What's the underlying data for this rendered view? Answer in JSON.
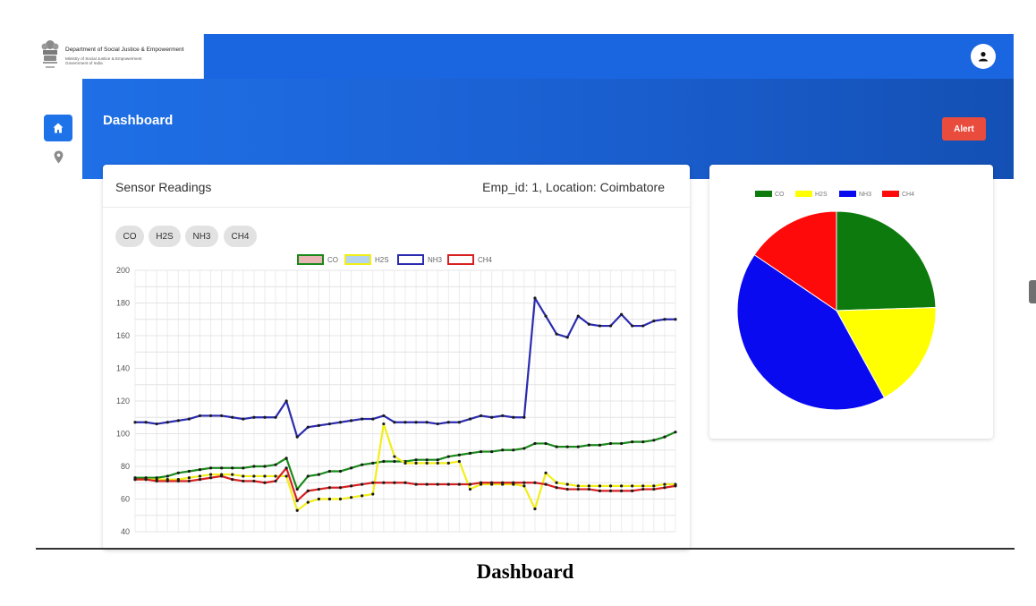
{
  "header": {
    "logo": {
      "title": "Department of Social Justice & Empowerment",
      "line2": "Ministry of Social Justice & Empowerment",
      "line3": "Government of India",
      "emblem_icon": "state-emblem-icon"
    },
    "user_icon": "user-icon",
    "color": "#1a66e0"
  },
  "sidebar": {
    "items": [
      {
        "icon": "home-icon",
        "active": true
      },
      {
        "icon": "location-pin-icon",
        "active": false
      }
    ]
  },
  "page": {
    "title": "Dashboard",
    "alert_label": "Alert",
    "alert_color": "#e94b3c"
  },
  "sensor_card": {
    "title": "Sensor Readings",
    "meta": "Emp_id: 1, Location: Coimbatore",
    "chips": [
      "CO",
      "H2S",
      "NH3",
      "CH4"
    ]
  },
  "chart_data": [
    {
      "type": "line",
      "legend": [
        "CO",
        "H2S",
        "NH3",
        "CH4"
      ],
      "legend_position": "top",
      "ylim": [
        40,
        200
      ],
      "yticks": [
        40,
        60,
        80,
        100,
        120,
        140,
        160,
        180,
        200
      ],
      "grid": true,
      "series": [
        {
          "name": "CO",
          "color": "#1a8a1a",
          "values": [
            73,
            73,
            73,
            74,
            76,
            77,
            78,
            79,
            79,
            79,
            79,
            80,
            80,
            81,
            85,
            66,
            74,
            75,
            77,
            77,
            79,
            81,
            82,
            83,
            83,
            83,
            84,
            84,
            84,
            86,
            87,
            88,
            89,
            89,
            90,
            90,
            91,
            94,
            94,
            92,
            92,
            92,
            93,
            93,
            94,
            94,
            95,
            95,
            96,
            98,
            101
          ]
        },
        {
          "name": "H2S",
          "color": "#f2ee1a",
          "values": [
            72,
            72,
            72,
            72,
            72,
            73,
            74,
            75,
            75,
            75,
            74,
            74,
            74,
            74,
            74,
            53,
            58,
            60,
            60,
            60,
            61,
            62,
            63,
            106,
            86,
            82,
            82,
            82,
            82,
            82,
            83,
            66,
            69,
            69,
            69,
            69,
            68,
            54,
            76,
            70,
            69,
            68,
            68,
            68,
            68,
            68,
            68,
            68,
            68,
            69,
            69
          ]
        },
        {
          "name": "NH3",
          "color": "#2b2bb0",
          "values": [
            107,
            107,
            106,
            107,
            108,
            109,
            111,
            111,
            111,
            110,
            109,
            110,
            110,
            110,
            120,
            98,
            104,
            105,
            106,
            107,
            108,
            109,
            109,
            111,
            107,
            107,
            107,
            107,
            106,
            107,
            107,
            109,
            111,
            110,
            111,
            110,
            110,
            183,
            172,
            161,
            159,
            172,
            167,
            166,
            166,
            173,
            166,
            166,
            169,
            170,
            170
          ]
        },
        {
          "name": "CH4",
          "color": "#d82020",
          "values": [
            72,
            72,
            71,
            71,
            71,
            71,
            72,
            73,
            74,
            72,
            71,
            71,
            70,
            71,
            79,
            59,
            65,
            66,
            67,
            67,
            68,
            69,
            70,
            70,
            70,
            70,
            69,
            69,
            69,
            69,
            69,
            69,
            70,
            70,
            70,
            70,
            70,
            70,
            69,
            67,
            66,
            66,
            66,
            65,
            65,
            65,
            65,
            66,
            66,
            67,
            68
          ]
        }
      ]
    },
    {
      "type": "pie",
      "legend": [
        "CO",
        "H2S",
        "NH3",
        "CH4"
      ],
      "legend_position": "top",
      "slices": [
        {
          "label": "CO",
          "value": 24.5,
          "color": "#0d7a0d"
        },
        {
          "label": "H2S",
          "value": 17.5,
          "color": "#ffff00"
        },
        {
          "label": "NH3",
          "value": 42.5,
          "color": "#0a0af0"
        },
        {
          "label": "CH4",
          "value": 15.5,
          "color": "#ff0a0a"
        }
      ]
    }
  ],
  "footer": {
    "caption": "Dashboard"
  }
}
